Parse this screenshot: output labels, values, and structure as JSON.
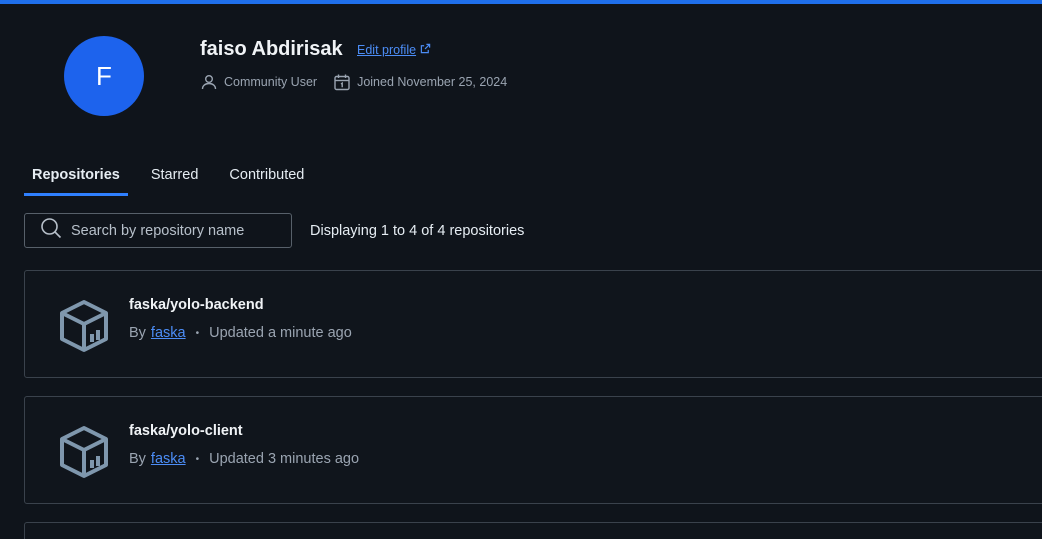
{
  "profile": {
    "avatar_letter": "F",
    "name": "faiso Abdirisak",
    "edit_label": "Edit profile",
    "role": "Community User",
    "joined": "Joined November 25, 2024"
  },
  "tabs": [
    {
      "label": "Repositories",
      "active": true
    },
    {
      "label": "Starred",
      "active": false
    },
    {
      "label": "Contributed",
      "active": false
    }
  ],
  "search": {
    "placeholder": "Search by repository name",
    "value": ""
  },
  "displaying": "Displaying 1 to 4 of 4 repositories",
  "repos": [
    {
      "name": "faska/yolo-backend",
      "by": "By",
      "owner": "faska",
      "separator": "•",
      "updated": "Updated a minute ago"
    },
    {
      "name": "faska/yolo-client",
      "by": "By",
      "owner": "faska",
      "separator": "•",
      "updated": "Updated 3 minutes ago"
    }
  ],
  "colors": {
    "accent": "#1f6feb",
    "avatar_bg": "#1d63ed",
    "link": "#4c8df6",
    "background": "#0f141b"
  },
  "icons": [
    "external-link-icon",
    "user-icon",
    "calendar-icon",
    "search-icon",
    "repository-icon"
  ]
}
